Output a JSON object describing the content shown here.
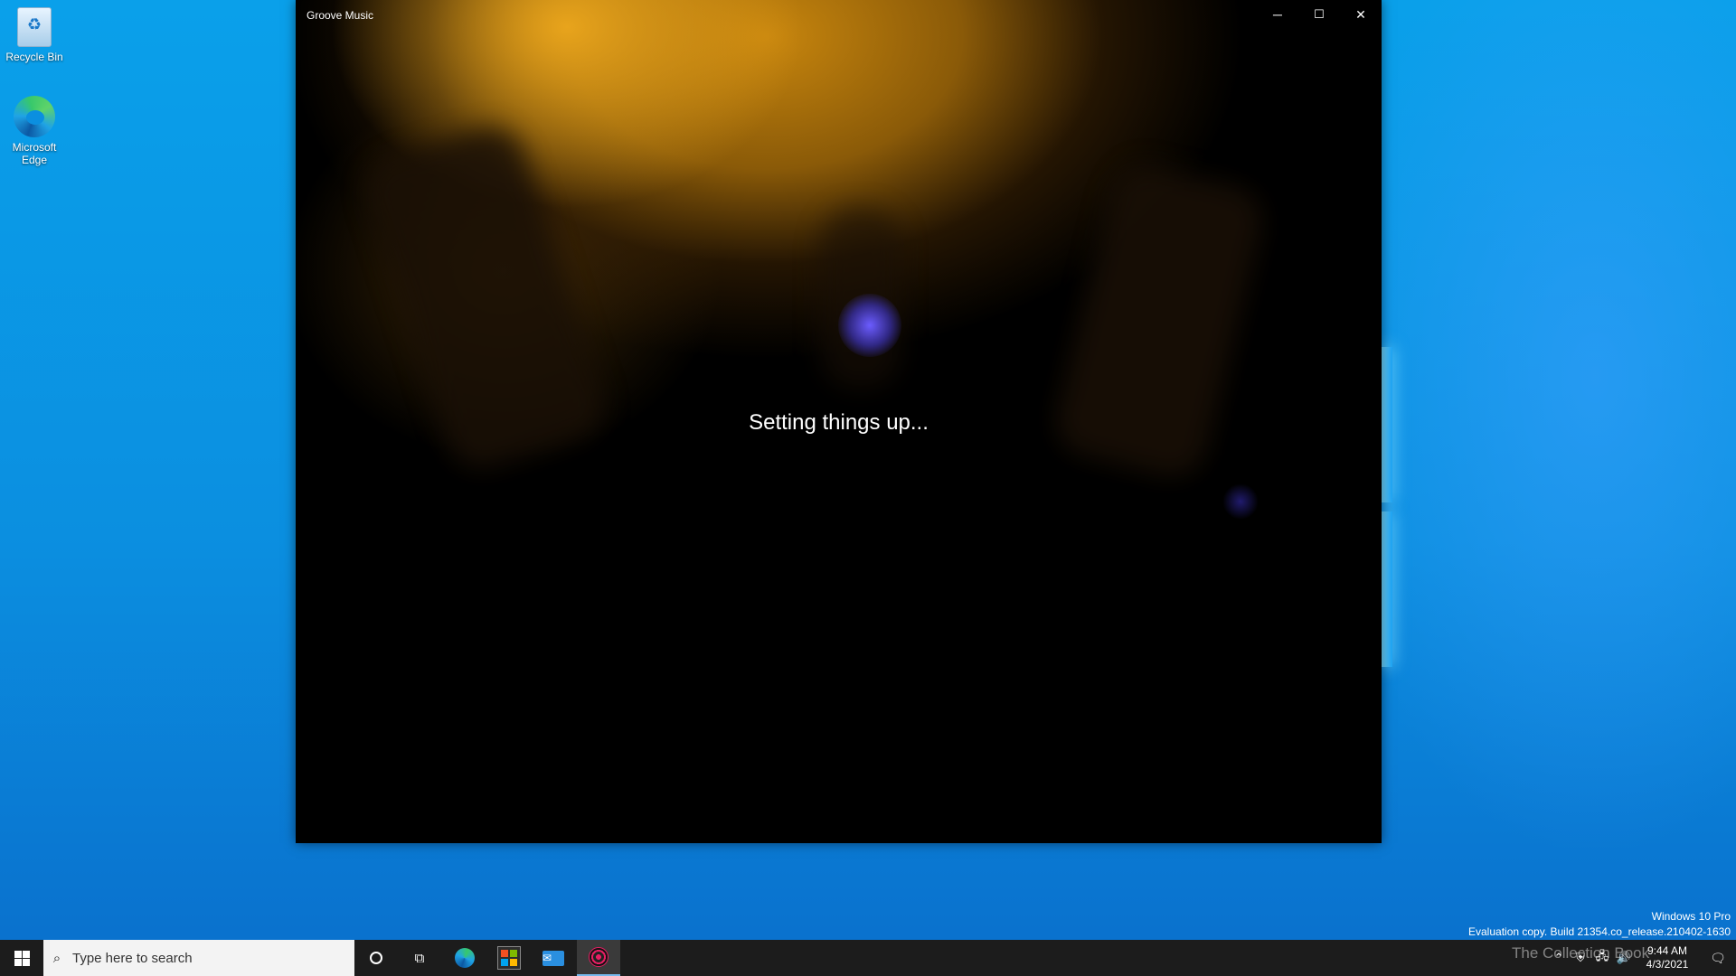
{
  "desktop": {
    "icons": [
      {
        "label": "Recycle Bin"
      },
      {
        "label": "Microsoft Edge"
      }
    ],
    "watermark": {
      "edition": "Windows 10 Pro",
      "build": "Evaluation copy. Build 21354.co_release.210402-1630"
    },
    "overlay_text": "The Collection Book"
  },
  "window": {
    "title": "Groove Music",
    "controls": {
      "minimize": "─",
      "maximize": "☐",
      "close": "✕"
    },
    "status": "Setting things up..."
  },
  "taskbar": {
    "search_placeholder": "Type here to search",
    "apps": [
      "cortana-icon",
      "task-view-icon",
      "edge-icon",
      "store-icon",
      "mail-icon",
      "groove-music-icon"
    ],
    "clock": {
      "time": "9:44 AM",
      "date": "4/3/2021"
    },
    "accent": "#76b9ed"
  }
}
